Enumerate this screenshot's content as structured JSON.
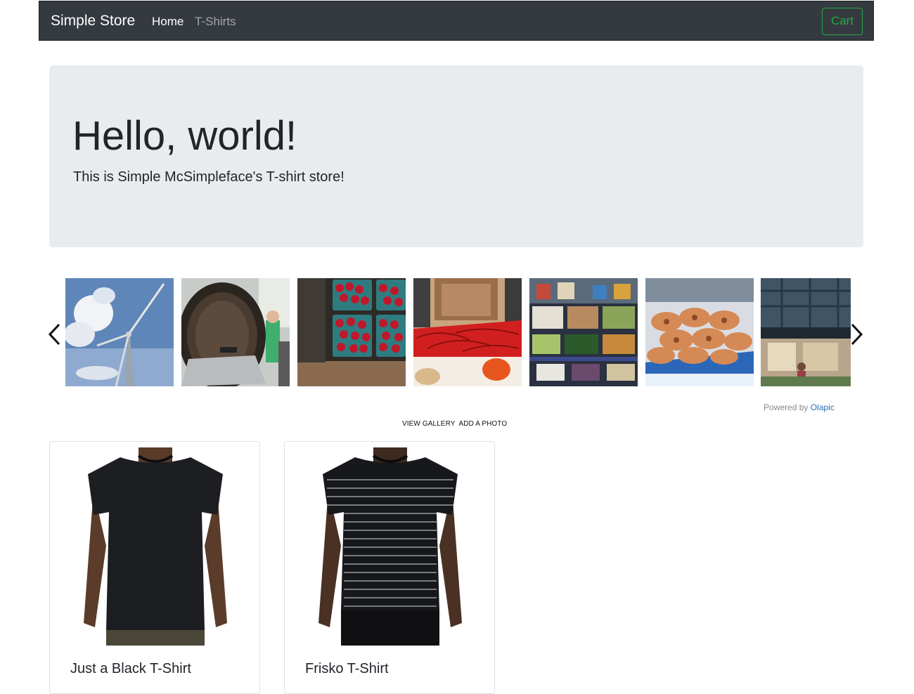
{
  "navbar": {
    "brand": "Simple Store",
    "links": [
      {
        "label": "Home",
        "active": true
      },
      {
        "label": "T-Shirts",
        "active": false
      }
    ],
    "cart_label": "Cart",
    "colors": {
      "background": "#343a40",
      "cart_accent": "#28a745"
    }
  },
  "hero": {
    "title": "Hello, world!",
    "lead": "This is Simple McSimpleface's T-shirt store!"
  },
  "gallery": {
    "thumbnails": [
      {
        "subject": "wind turbine"
      },
      {
        "subject": "industrial chamber with worker"
      },
      {
        "subject": "raspberries"
      },
      {
        "subject": "red chili peppers"
      },
      {
        "subject": "market produce stall"
      },
      {
        "subject": "crabs on ice"
      },
      {
        "subject": "shopping mall storefront"
      }
    ],
    "powered_by_prefix": "Powered by",
    "powered_by_brand": "Olapic",
    "view_gallery": "VIEW GALLERY",
    "add_photo": "ADD A PHOTO"
  },
  "products": [
    {
      "name": "Just a Black T-Shirt",
      "style": "solid-black"
    },
    {
      "name": "Frisko T-Shirt",
      "style": "black-striped"
    }
  ]
}
